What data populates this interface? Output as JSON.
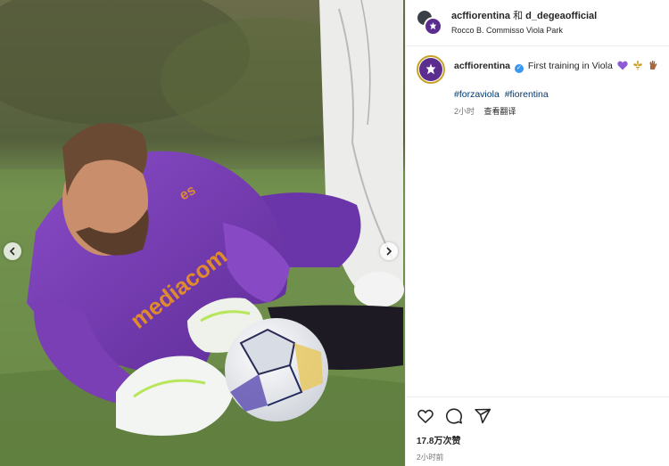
{
  "post": {
    "header": {
      "username": "acffiorentina",
      "joiner": "和",
      "collaborator": "d_degeaofficial",
      "location": "Rocco B. Commisso Viola Park"
    },
    "caption": {
      "username": "acffiorentina",
      "text": "First training in Viola",
      "emojis": [
        "purple-heart",
        "fleur-de-lis",
        "glove"
      ],
      "hashtags": [
        "#forzaviola",
        "#fiorentina"
      ],
      "time_ago": "2小时",
      "translate_label": "查看翻译"
    },
    "footer": {
      "likes": "17.8万次赞",
      "time_ago": "2小时前"
    }
  },
  "colors": {
    "viola": "#5b2d8e",
    "link": "#00376b",
    "verified": "#3897f0",
    "muted": "#737373",
    "jersey": "#7b3fb6",
    "grass": "#6f8a52"
  },
  "icons": {
    "carousel_prev": "chevron-left-icon",
    "carousel_next": "chevron-right-icon",
    "like": "heart-icon",
    "comment": "comment-icon",
    "share": "send-icon"
  }
}
